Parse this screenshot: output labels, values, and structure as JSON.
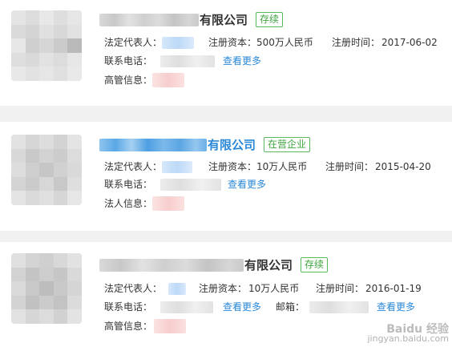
{
  "companies": [
    {
      "name_suffix": "有限公司",
      "status": "存续",
      "legal_rep_label": "法定代表人：",
      "capital_label": "注册资本：",
      "capital_value": "500万人民币",
      "reg_time_label": "注册时间：",
      "reg_time_value": "2017-06-02",
      "phone_label": "联系电话：",
      "more_link": "查看更多",
      "extra_label": "高管信息："
    },
    {
      "name_suffix": "有限公司",
      "status": "在营企业",
      "legal_rep_label": "法定代表人：",
      "capital_label": "注册资本：",
      "capital_value": "10万人民币",
      "reg_time_label": "注册时间：",
      "reg_time_value": "2015-04-20",
      "phone_label": "联系电话：",
      "more_link": "查看更多",
      "extra_label": "法人信息："
    },
    {
      "name_suffix": "有限公司",
      "status": "存续",
      "legal_rep_label": "法定代表人：",
      "capital_label": "注册资本：",
      "capital_value": "10万人民币",
      "reg_time_label": "注册时间：",
      "reg_time_value": "2016-01-19",
      "phone_label": "联系电话：",
      "more_link": "查看更多",
      "email_label": "邮箱：",
      "email_more_link": "查看更多",
      "extra_label": "高管信息："
    }
  ],
  "watermark": {
    "line1": "Baidu 经验",
    "line2": "jingyan.baidu.com"
  },
  "colors": {
    "link": "#2a88d8",
    "badge_green": "#3fa33f",
    "title_blue": "#2a88d8"
  }
}
